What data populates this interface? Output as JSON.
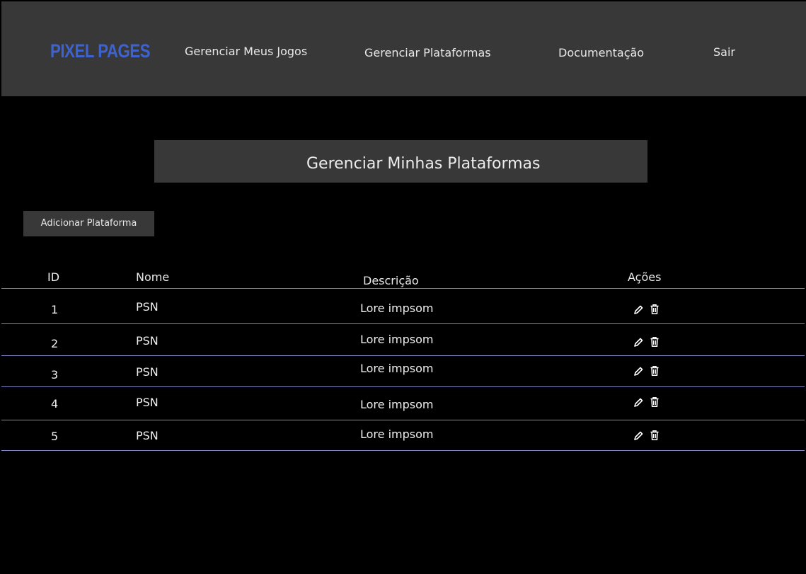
{
  "header": {
    "logo": "PIXEL PAGES",
    "nav": [
      {
        "label": "Gerenciar Meus Jogos"
      },
      {
        "label": "Gerenciar Plataformas"
      },
      {
        "label": "Documentação"
      },
      {
        "label": "Sair"
      }
    ],
    "logo_color": "#3f63ce",
    "bar_color": "#383838"
  },
  "main": {
    "title": "Gerenciar Minhas Plataformas",
    "add_button": "Adicionar Plataforma"
  },
  "table": {
    "columns": [
      "ID",
      "Nome",
      "Descrição",
      "Ações"
    ],
    "rows": [
      {
        "id": "1",
        "nome": "PSN",
        "descricao": "Lore impsom",
        "actions": [
          "pencil-icon",
          "trash-icon"
        ]
      },
      {
        "id": "2",
        "nome": "PSN",
        "descricao": "Lore impsom",
        "actions": [
          "pencil-icon",
          "trash-icon"
        ]
      },
      {
        "id": "3",
        "nome": "PSN",
        "descricao": "Lore impsom",
        "actions": [
          "pencil-icon",
          "trash-icon"
        ]
      },
      {
        "id": "4",
        "nome": "PSN",
        "descricao": "Lore impsom",
        "actions": [
          "pencil-icon",
          "trash-icon"
        ]
      },
      {
        "id": "5",
        "nome": "PSN",
        "descricao": "Lore impsom",
        "actions": [
          "pencil-icon",
          "trash-icon"
        ]
      }
    ],
    "divider_color": "#7e86c4"
  }
}
